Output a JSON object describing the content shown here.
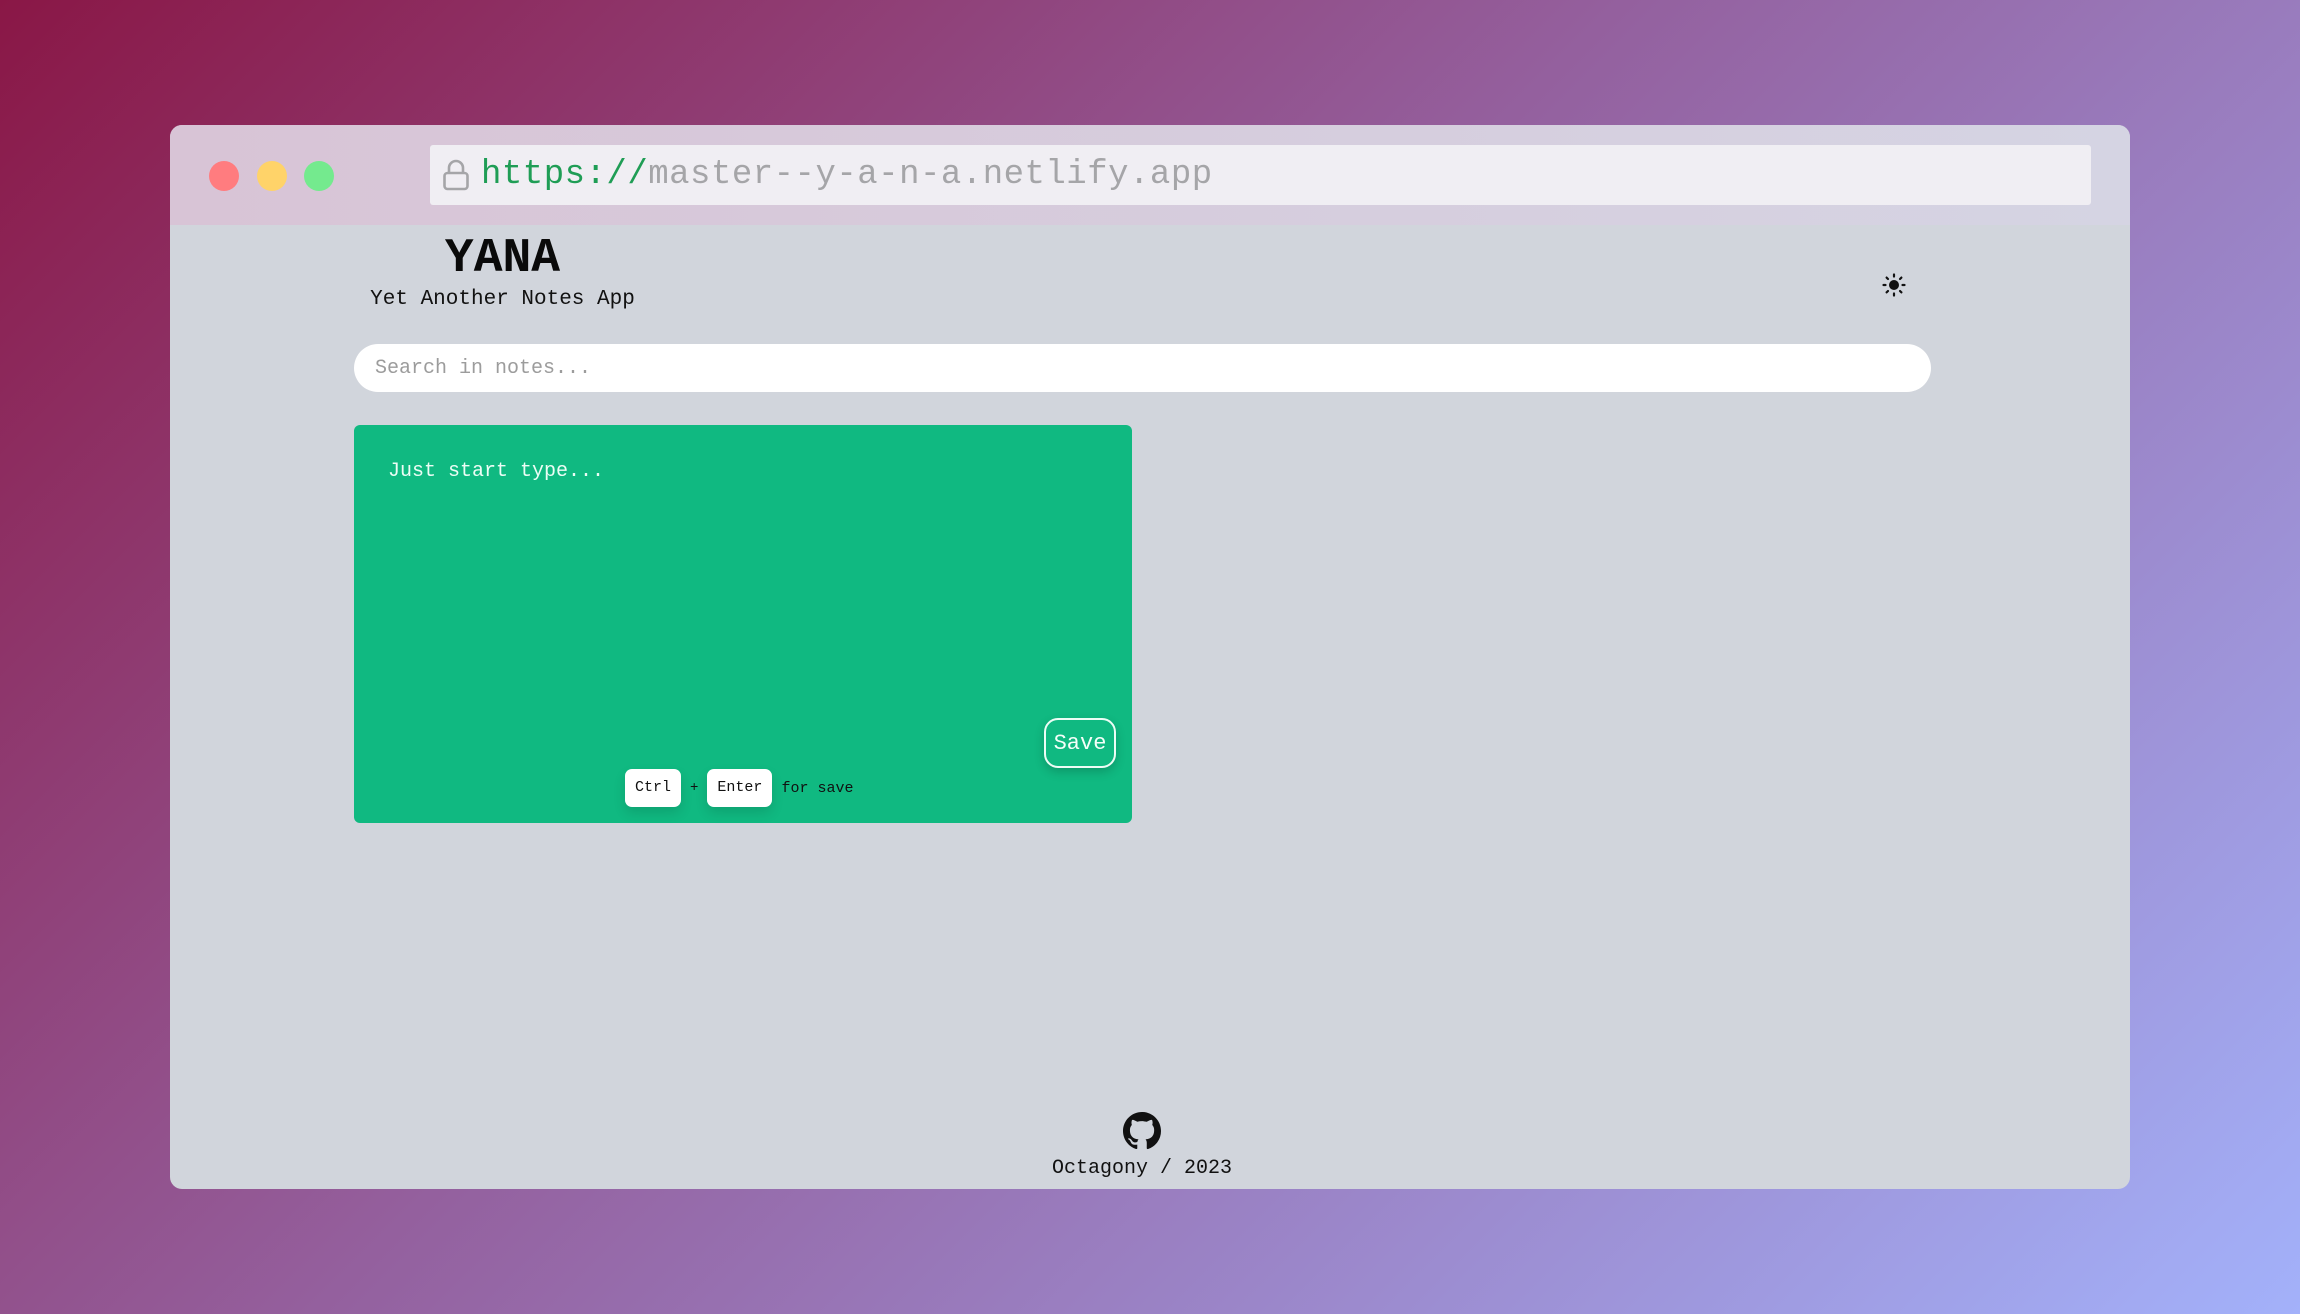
{
  "browser": {
    "url_scheme": "https://",
    "url_host": "master--y-a-n-a.netlify.app"
  },
  "header": {
    "title": "YANA",
    "subtitle": "Yet Another Notes App",
    "theme_icon": "sun-icon"
  },
  "search": {
    "placeholder": "Search in notes..."
  },
  "note_editor": {
    "placeholder": "Just start type...",
    "save_label": "Save",
    "shortcut_key1": "Ctrl",
    "shortcut_plus": "+",
    "shortcut_key2": "Enter",
    "shortcut_hint": "for save",
    "card_color": "#10b981"
  },
  "footer": {
    "icon": "github-icon",
    "text": "Octagony / 2023"
  }
}
